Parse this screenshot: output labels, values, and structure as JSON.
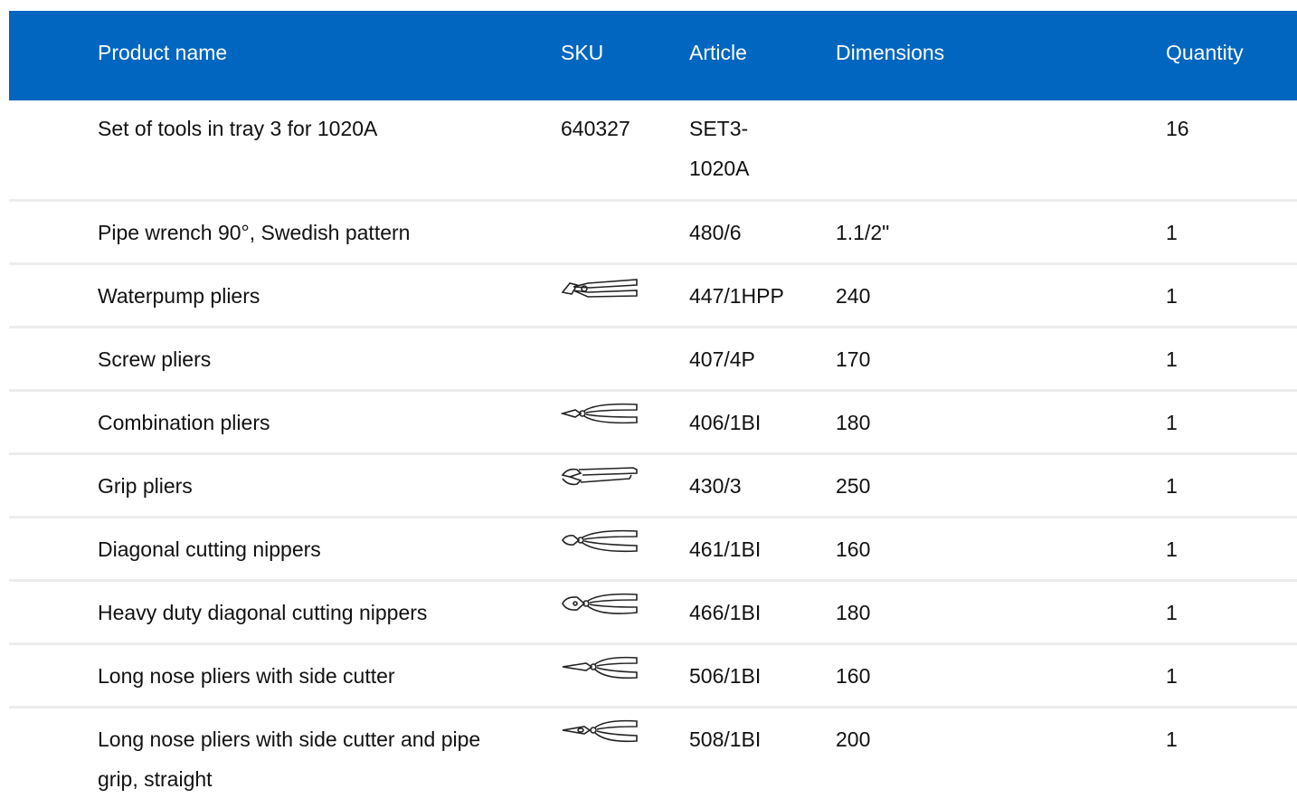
{
  "header": {
    "product_name": "Product name",
    "sku": "SKU",
    "article": "Article",
    "dimensions": "Dimensions",
    "quantity": "Quantity"
  },
  "rows": [
    {
      "name": "Set of tools in tray 3 for 1020A",
      "sku": "640327",
      "article": "SET3-1020A",
      "dimensions": "",
      "quantity": "16",
      "icon": ""
    },
    {
      "name": "Pipe wrench 90°, Swedish pattern",
      "sku": "",
      "article": "480/6",
      "dimensions": "1.1/2\"",
      "quantity": "1",
      "icon": ""
    },
    {
      "name": "Waterpump pliers",
      "sku": "",
      "article": "447/1HPP",
      "dimensions": "240",
      "quantity": "1",
      "icon": "waterpump-pliers-icon"
    },
    {
      "name": "Screw pliers",
      "sku": "",
      "article": "407/4P",
      "dimensions": "170",
      "quantity": "1",
      "icon": ""
    },
    {
      "name": "Combination pliers",
      "sku": "",
      "article": "406/1BI",
      "dimensions": "180",
      "quantity": "1",
      "icon": "combination-pliers-icon"
    },
    {
      "name": "Grip pliers",
      "sku": "",
      "article": "430/3",
      "dimensions": "250",
      "quantity": "1",
      "icon": "grip-pliers-icon"
    },
    {
      "name": "Diagonal cutting nippers",
      "sku": "",
      "article": "461/1BI",
      "dimensions": "160",
      "quantity": "1",
      "icon": "diagonal-cutting-nippers-icon"
    },
    {
      "name": "Heavy duty diagonal cutting nippers",
      "sku": "",
      "article": "466/1BI",
      "dimensions": "180",
      "quantity": "1",
      "icon": "heavy-duty-nippers-icon"
    },
    {
      "name": "Long nose pliers with side cutter",
      "sku": "",
      "article": "506/1BI",
      "dimensions": "160",
      "quantity": "1",
      "icon": "long-nose-pliers-icon"
    },
    {
      "name": "Long nose pliers with side cutter and pipe grip, straight",
      "sku": "",
      "article": "508/1BI",
      "dimensions": "200",
      "quantity": "1",
      "icon": "long-nose-pliers-pipe-grip-icon"
    }
  ],
  "colors": {
    "header_bg": "#0066c0",
    "header_text": "#ffffff",
    "row_divider": "#ececec"
  }
}
